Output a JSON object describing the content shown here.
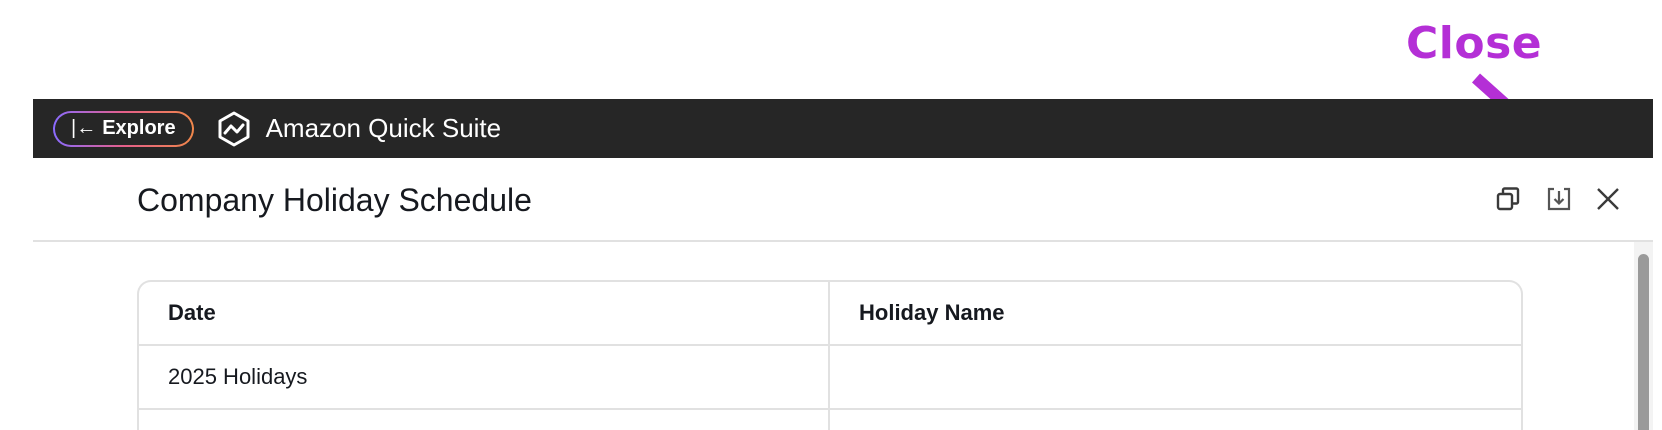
{
  "annotation": {
    "label": "Close",
    "color": "#b42fd6"
  },
  "topbar": {
    "explore_label": "Explore",
    "explore_icon": "|←",
    "brand_name": "Amazon Quick Suite",
    "background": "#262626"
  },
  "panel": {
    "title": "Company Holiday Schedule",
    "actions": [
      {
        "name": "copy-icon"
      },
      {
        "name": "download-icon"
      },
      {
        "name": "close-icon"
      }
    ]
  },
  "table": {
    "columns": [
      "Date",
      "Holiday Name"
    ],
    "rows": [
      [
        "2025 Holidays",
        ""
      ]
    ]
  }
}
